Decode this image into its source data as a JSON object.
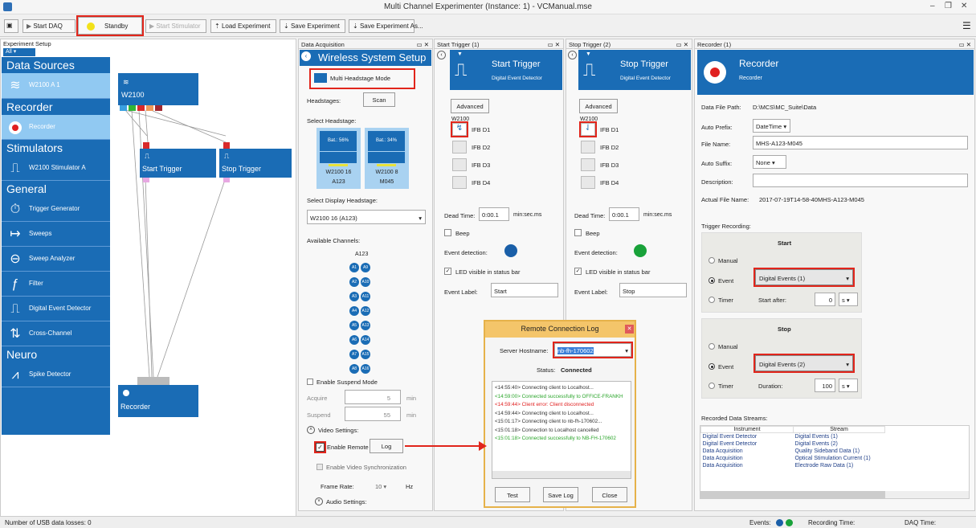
{
  "window": {
    "title": "Multi Channel Experimenter (Instance: 1) - VCManual.mse"
  },
  "toolbar": {
    "start_daq": "Start DAQ",
    "standby": "Standby",
    "start_stimulator": "Start Stimulator",
    "load_experiment": "Load Experiment",
    "save_experiment": "Save Experiment",
    "save_experiment_as": "Save Experiment As..."
  },
  "experiment_setup": {
    "title": "Experiment Setup",
    "filter": "All",
    "categories": {
      "data_sources": "Data Sources",
      "recorder": "Recorder",
      "stimulators": "Stimulators",
      "general": "General",
      "neuro": "Neuro"
    },
    "items": {
      "w2100": "W2100   A   1",
      "recorder": "Recorder",
      "w2100_stimulator": "W2100 Stimulator   A",
      "trigger_generator": "Trigger Generator",
      "sweeps": "Sweeps",
      "sweep_analyzer": "Sweep Analyzer",
      "filter": "Filter",
      "digital_event_detector": "Digital Event Detector",
      "cross_channel": "Cross-Channel",
      "spike_detector": "Spike Detector"
    },
    "canvas": {
      "w2100": "W2100",
      "start_trigger": "Start Trigger",
      "stop_trigger": "Stop Trigger",
      "recorder": "Recorder"
    }
  },
  "daq": {
    "panel_title": "Data Acquisition",
    "heading": "Wireless System Setup",
    "multi_headstage": "Multi Headstage Mode",
    "headstages_label": "Headstages:",
    "scan": "Scan",
    "select_headstage": "Select Headstage:",
    "hs1": {
      "bat": "Bat.: 56%",
      "name": "W2100 16",
      "id": "A123"
    },
    "hs2": {
      "bat": "Bat.: 34%",
      "name": "W2100 8",
      "id": "M045"
    },
    "select_display": "Select Display Headstage:",
    "display_value": "W2100 16 (A123)",
    "available_channels": "Available Channels:",
    "channel_group": "A123",
    "channels": [
      "A1",
      "A9",
      "A2",
      "A10",
      "A3",
      "A11",
      "A4",
      "A12",
      "A5",
      "A13",
      "A6",
      "A14",
      "A7",
      "A15",
      "A8",
      "A16"
    ],
    "enable_suspend": "Enable Suspend Mode",
    "acquire": "Acquire",
    "acquire_val": "5",
    "suspend": "Suspend",
    "suspend_val": "55",
    "min": "min",
    "video_settings": "Video Settings:",
    "enable_remote": "Enable Remote",
    "log": "Log",
    "enable_video_sync": "Enable Video Synchronization",
    "frame_rate": "Frame Rate:",
    "frame_rate_val": "10",
    "hz": "Hz",
    "audio_settings": "Audio Settings:"
  },
  "start_trigger": {
    "panel_title": "Start Trigger (1)",
    "title": "Start Trigger",
    "subtitle": "Digital Event Detector",
    "advanced": "Advanced",
    "device": "W2100",
    "ifb": [
      "IFB D1",
      "IFB D2",
      "IFB D3",
      "IFB D4"
    ],
    "dead_time_label": "Dead Time:",
    "dead_time": "0:00.1",
    "unit": "min:sec.ms",
    "beep": "Beep",
    "event_detection": "Event detection:",
    "led": "LED visible in status bar",
    "event_label": "Event Label:",
    "event_value": "Start",
    "led_color": "#1a5fa8"
  },
  "stop_trigger": {
    "panel_title": "Stop Trigger (2)",
    "title": "Stop Trigger",
    "subtitle": "Digital Event Detector",
    "advanced": "Advanced",
    "device": "W2100",
    "ifb": [
      "IFB D1",
      "IFB D2",
      "IFB D3",
      "IFB D4"
    ],
    "dead_time_label": "Dead Time:",
    "dead_time": "0:00.1",
    "unit": "min:sec.ms",
    "beep": "Beep",
    "event_detection": "Event detection:",
    "led": "LED visible in status bar",
    "event_label": "Event Label:",
    "event_value": "Stop",
    "led_color": "#19a23a"
  },
  "recorder": {
    "panel_title": "Recorder (1)",
    "title": "Recorder",
    "subtitle": "Recorder",
    "data_path_label": "Data File Path:",
    "data_path": "D:\\MCS\\MC_Suite\\Data",
    "auto_prefix_label": "Auto Prefix:",
    "auto_prefix": "DateTime",
    "file_name_label": "File Name:",
    "file_name": "MHS-A123-M045",
    "auto_suffix_label": "Auto Suffix:",
    "auto_suffix": "None",
    "description_label": "Description:",
    "actual_label": "Actual File Name:",
    "actual": "2017-07-19T14-58-40MHS-A123-M045",
    "trigger_recording": "Trigger Recording:",
    "start": "Start",
    "stop": "Stop",
    "manual": "Manual",
    "event": "Event",
    "timer": "Timer",
    "start_event": "Digital Events (1)",
    "stop_event": "Digital Events (2)",
    "start_after": "Start after:",
    "start_after_val": "0",
    "duration": "Duration:",
    "duration_val": "100",
    "s": "s",
    "streams_label": "Recorded Data Streams:",
    "col_instrument": "Instrument",
    "col_stream": "Stream",
    "streams": [
      [
        "Digital Event Detector",
        "Digital Events (1)"
      ],
      [
        "Digital Event Detector",
        "Digital Events (2)"
      ],
      [
        "Data Acquisition",
        "Quality Sideband Data (1)"
      ],
      [
        "Data Acquisition",
        "Optical Stimulation Current (1)"
      ],
      [
        "Data Acquisition",
        "Electrode Raw Data (1)"
      ]
    ]
  },
  "remote_log": {
    "title": "Remote Connection Log",
    "hostname_label": "Server Hostname:",
    "hostname": "nb-fh-170602",
    "status_label": "Status:",
    "status": "Connected",
    "lines": [
      {
        "t": "<14:55:40> Connecting client to Localhost...",
        "c": "#333"
      },
      {
        "t": "<14:59:00> Connected successfully to OFFICE-FRANKH",
        "c": "#2aa52a"
      },
      {
        "t": "<14:59:44> Client error: Client disconnected",
        "c": "#e02020"
      },
      {
        "t": "<14:59:44> Connecting client to Localhost...",
        "c": "#333"
      },
      {
        "t": "<15:01:17> Connecting client to nb-fh-170602...",
        "c": "#333"
      },
      {
        "t": "<15:01:18> Connection to Localhost cancelled",
        "c": "#333"
      },
      {
        "t": "<15:01:18> Connected successfully to NB-FH-170602",
        "c": "#2aa52a"
      }
    ],
    "test": "Test",
    "save_log": "Save Log",
    "close": "Close"
  },
  "status": {
    "usb_losses": "Number of USB data losses: 0",
    "events": "Events:",
    "recording_time": "Recording Time:",
    "daq_time": "DAQ Time:"
  }
}
